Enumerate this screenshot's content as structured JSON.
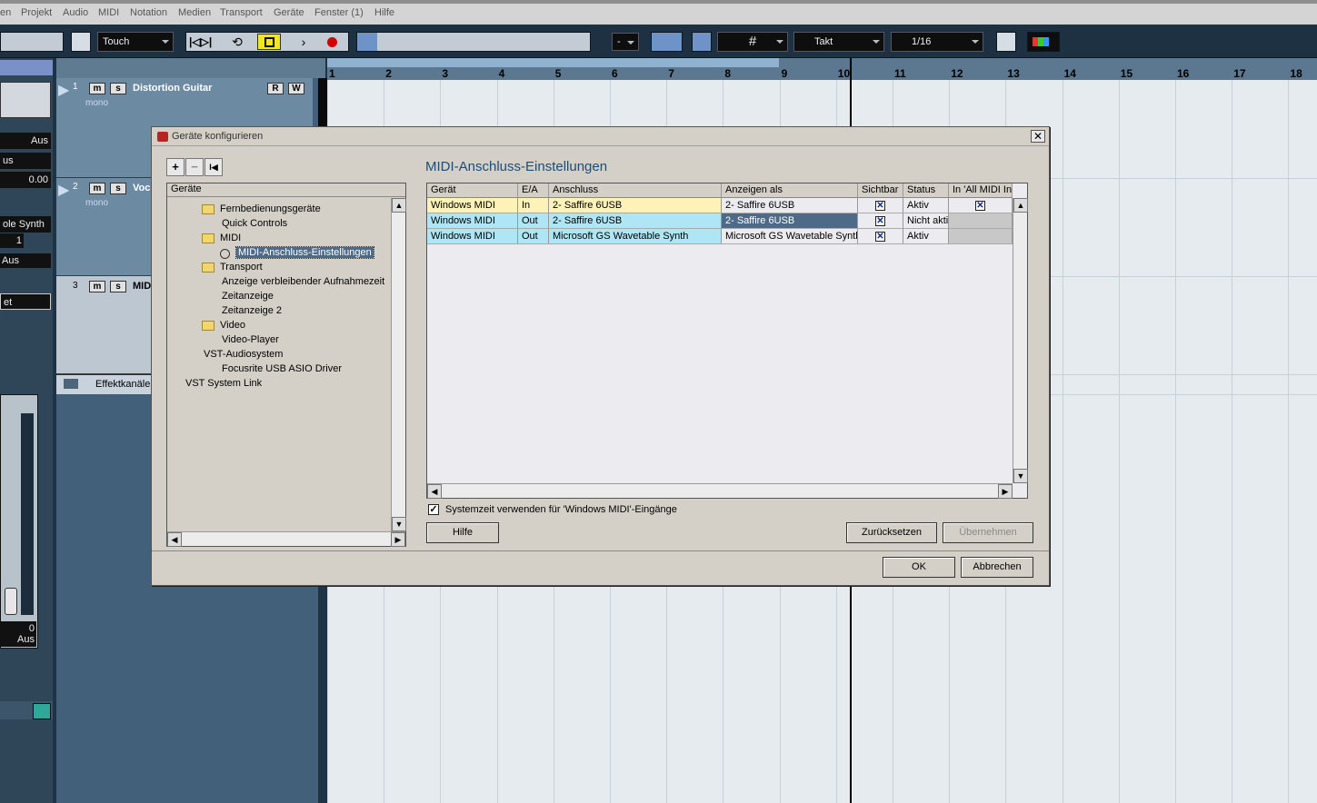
{
  "menu": [
    "en",
    "Projekt",
    "Audio",
    "MIDI",
    "Notation",
    "Medien",
    "Transport",
    "Geräte",
    "Fenster (1)",
    "Hilfe"
  ],
  "toolbar": {
    "automation_mode": "Touch",
    "quantize_separator": "-",
    "grid_type": "Takt",
    "quantize": "1/16"
  },
  "ruler": {
    "ticks": [
      "1",
      "2",
      "3",
      "4",
      "5",
      "6",
      "7",
      "8",
      "9",
      "10",
      "11",
      "12",
      "13",
      "14",
      "15",
      "16",
      "17",
      "18"
    ]
  },
  "inspector": {
    "aus1": "Aus",
    "us": "us",
    "value": "0.00",
    "synth": "ole Synth",
    "channel": "1",
    "aus2": "Aus",
    "et": "et",
    "fader_value": "0",
    "aus3": "Aus"
  },
  "tracks": [
    {
      "num": "1",
      "name": "Distortion Guitar",
      "sub": "mono",
      "m": "m",
      "s": "s",
      "r": "R",
      "w": "W"
    },
    {
      "num": "2",
      "name": "Voc",
      "sub": "mono",
      "m": "m",
      "s": "s"
    },
    {
      "num": "3",
      "name": "MIDI",
      "m": "m",
      "s": "s"
    }
  ],
  "effekt_label": "Effektkanäle",
  "dialog": {
    "title": "Geräte konfigurieren",
    "close": "✕",
    "heading": "MIDI-Anschluss-Einstellungen",
    "add": "+",
    "remove": "−",
    "reset": "I◀",
    "tree_header": "Geräte",
    "tree": [
      {
        "label": "Fernbedienungsgeräte",
        "level": 1,
        "folder": true
      },
      {
        "label": "Quick Controls",
        "level": 2
      },
      {
        "label": "MIDI",
        "level": 1,
        "folder": true
      },
      {
        "label": "MIDI-Anschluss-Einstellungen",
        "level": 2,
        "selected": true
      },
      {
        "label": "Transport",
        "level": 1,
        "folder": true
      },
      {
        "label": "Anzeige verbleibender Aufnahmezeit",
        "level": 2
      },
      {
        "label": "Zeitanzeige",
        "level": 2
      },
      {
        "label": "Zeitanzeige 2",
        "level": 2
      },
      {
        "label": "Video",
        "level": 1,
        "folder": true
      },
      {
        "label": "Video-Player",
        "level": 2
      },
      {
        "label": "VST-Audiosystem",
        "level": 1
      },
      {
        "label": "Focusrite USB ASIO Driver",
        "level": 2
      },
      {
        "label": "VST System Link",
        "level": 0
      }
    ],
    "columns": [
      "Gerät",
      "E/A",
      "Anschluss",
      "Anzeigen als",
      "Sichtbar",
      "Status",
      "In 'All MIDI In"
    ],
    "rows": [
      {
        "geraet": "Windows MIDI",
        "ea": "In",
        "anschluss": "2- Saffire 6USB",
        "anzeigen": "2- Saffire 6USB",
        "sichtbar": true,
        "status": "Aktiv",
        "allmidi": true
      },
      {
        "geraet": "Windows MIDI",
        "ea": "Out",
        "anschluss": "2- Saffire 6USB",
        "anzeigen": "2- Saffire 6USB",
        "sichtbar": true,
        "status": "Nicht aktiv",
        "allmidi": false
      },
      {
        "geraet": "Windows MIDI",
        "ea": "Out",
        "anschluss": "Microsoft GS Wavetable Synth",
        "anzeigen": "Microsoft GS Wavetable Synth",
        "sichtbar": true,
        "status": "Aktiv",
        "allmidi": false
      }
    ],
    "systemzeit_label": "Systemzeit verwenden für 'Windows MIDI'-Eingänge",
    "hilfe": "Hilfe",
    "zuruecksetzen": "Zurücksetzen",
    "uebernehmen": "Übernehmen",
    "ok": "OK",
    "abbrechen": "Abbrechen"
  },
  "colors": {
    "row_in": "#fdf2b8",
    "row_out": "#aee6f5",
    "selected_cell": "#4d6a88",
    "heading": "#1a4e7a"
  }
}
